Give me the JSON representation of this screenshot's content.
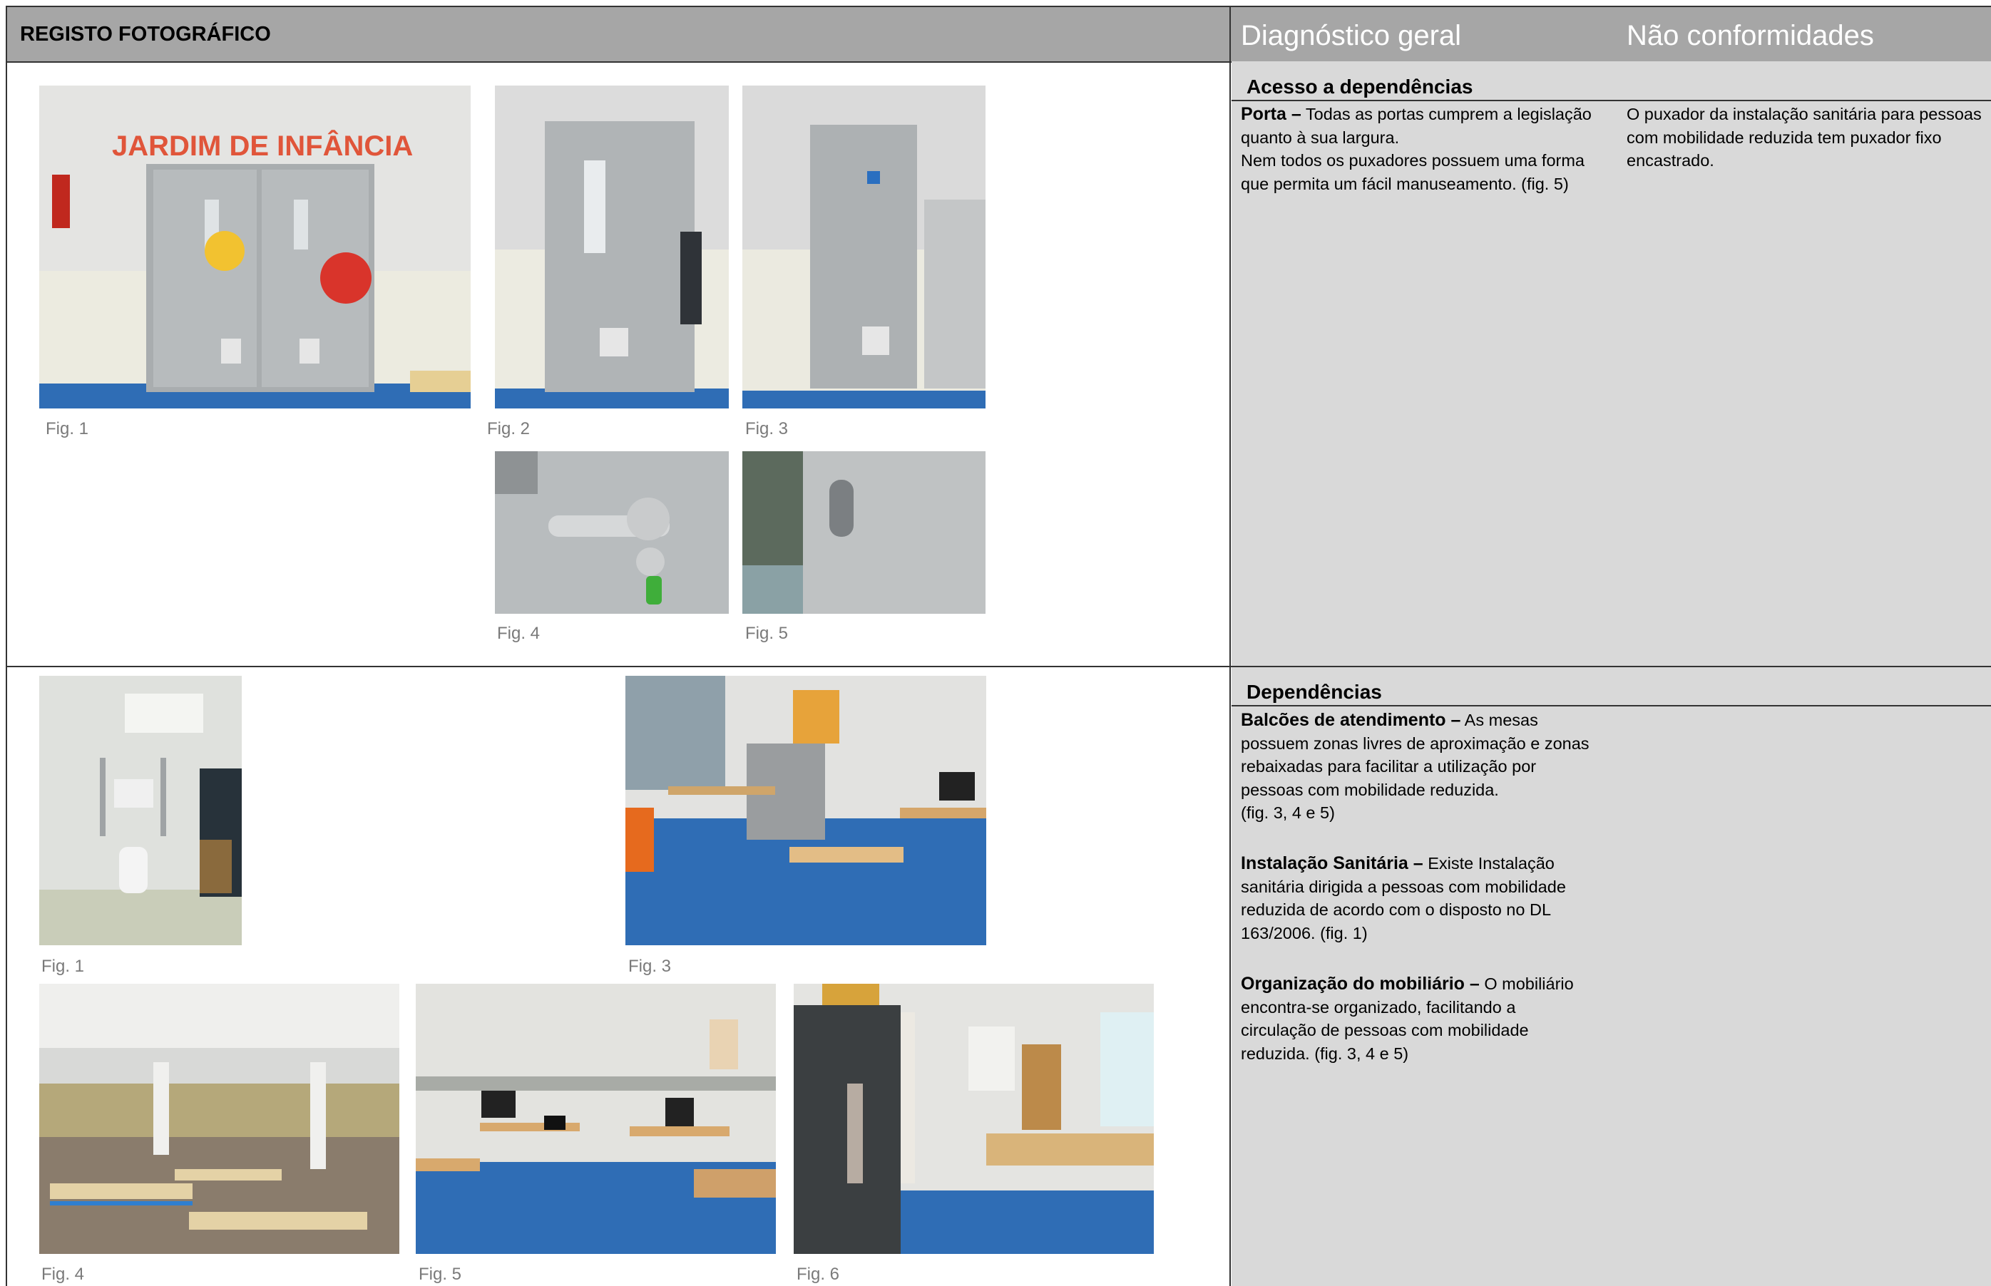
{
  "header": {
    "title": "REGISTO FOTOGRÁFICO",
    "col_diagnostico": "Diagnóstico geral",
    "col_nao_conformidades": "Não conformidades"
  },
  "section1": {
    "title": "Acesso a dependências",
    "diagnostico": {
      "term": "Porta –",
      "text": " Todas as portas cumprem a legislação\nquanto à sua largura.\nNem todos os puxadores possuem uma forma\nque permita um fácil manuseamento. (fig. 5)"
    },
    "nao_conformidades": "O puxador da instalação sanitária para pessoas\ncom mobilidade reduzida tem puxador fixo\nencastrado.",
    "photos": [
      {
        "caption": "Fig. 1",
        "subject": "double-door-kindergarten"
      },
      {
        "caption": "Fig. 2",
        "subject": "single-door-window"
      },
      {
        "caption": "Fig. 3",
        "subject": "sliding-door-accessible"
      },
      {
        "caption": "Fig. 4",
        "subject": "lever-handle"
      },
      {
        "caption": "Fig. 5",
        "subject": "recessed-handle"
      }
    ],
    "door_sign": "JARDIM DE INFÂNCIA"
  },
  "section2": {
    "title": "Dependências",
    "items": [
      {
        "term": "Balcões de atendimento",
        "dash": " –",
        "text": " As mesas\npossuem zonas livres de aproximação e zonas\nrebaixadas para facilitar a utilização por\npessoas com mobilidade reduzida.\n(fig. 3, 4 e 5)"
      },
      {
        "term": "Instalação Sanitária –",
        "dash": "",
        "text": " Existe Instalação\nsanitária dirigida a pessoas com mobilidade\nreduzida de acordo com o disposto no DL\n163/2006. (fig. 1)"
      },
      {
        "term": "Organização do mobiliário –",
        "dash": "",
        "text": " O mobiliário\nencontra-se organizado, facilitando a\ncirculação de pessoas com mobilidade\nreduzida. (fig. 3, 4 e 5)"
      }
    ],
    "photos": [
      {
        "caption": "Fig. 1",
        "subject": "accessible-toilet"
      },
      {
        "caption": "Fig. 3",
        "subject": "office-desks"
      },
      {
        "caption": "Fig. 4",
        "subject": "canteen-tables"
      },
      {
        "caption": "Fig. 5",
        "subject": "computer-room"
      },
      {
        "caption": "Fig. 6",
        "subject": "classroom"
      }
    ]
  },
  "colors": {
    "header_bg": "#a6a6a6",
    "panel_bg": "#d9d9d9",
    "caption": "#7a7a7a",
    "floor_blue": "#2f6db5"
  }
}
